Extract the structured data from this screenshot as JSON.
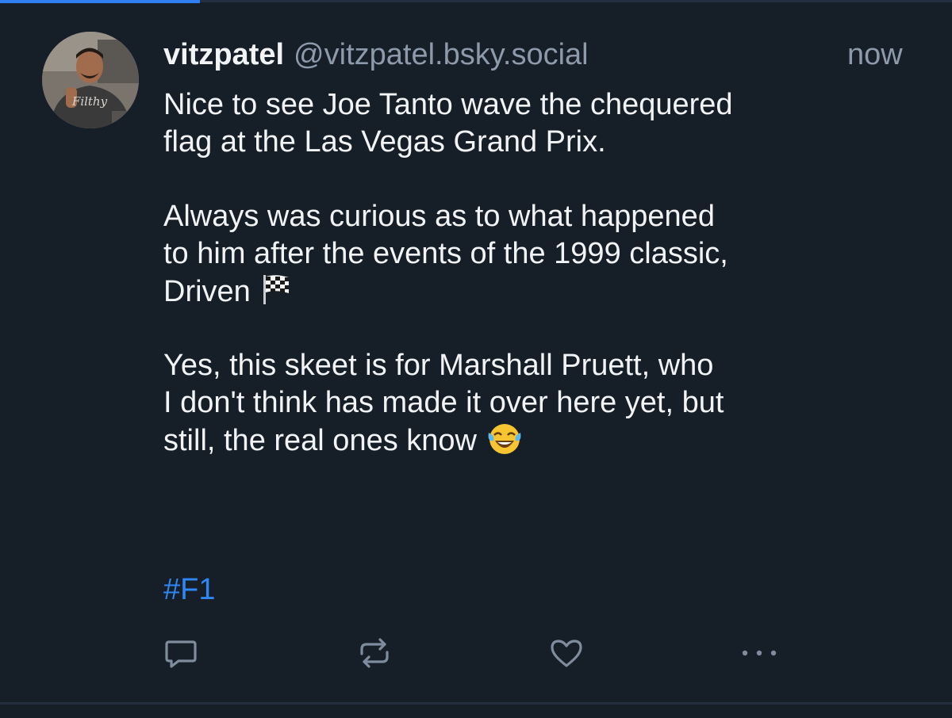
{
  "post": {
    "author": {
      "display_name": "vitzpatel",
      "handle": "@vitzpatel.bsky.social",
      "avatar_text": "Filthy"
    },
    "timestamp": "now",
    "lines": {
      "p1": "Nice to see Joe Tanto wave the chequered",
      "p2": "flag at the Las Vegas Grand Prix.",
      "p3": "Always was curious as to what happened",
      "p4": "to him after the events of the 1999 classic,",
      "p5": "Driven",
      "p6": "Yes, this skeet is for Marshall Pruett, who",
      "p7": "I don't think has made it over here yet, but",
      "p8": "still, the real ones know"
    },
    "emojis": {
      "flag": "chequered-flag",
      "laugh": "face-with-tears-of-joy"
    },
    "hashtag": "#F1"
  },
  "actions": [
    {
      "name": "reply",
      "icon": "speech-bubble-icon"
    },
    {
      "name": "repost",
      "icon": "repost-arrows-icon"
    },
    {
      "name": "like",
      "icon": "heart-icon"
    },
    {
      "name": "more",
      "icon": "ellipsis-icon"
    }
  ],
  "colors": {
    "background": "#161e27",
    "divider": "#232e3e",
    "accent": "#2f7ff2",
    "text": "#f1f3f5",
    "muted": "#8c9aab",
    "link": "#2f87f5",
    "icon": "#7e8c9d"
  }
}
